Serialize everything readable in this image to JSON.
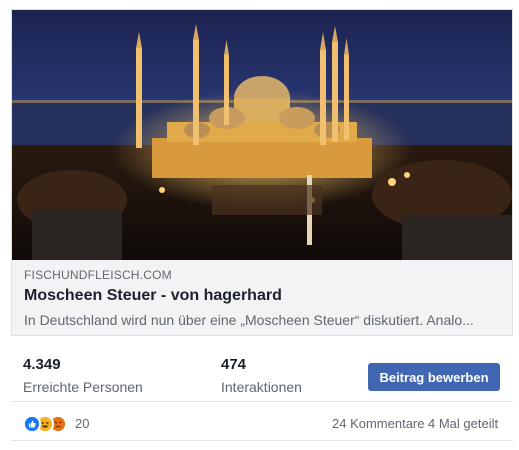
{
  "link_preview": {
    "image_alt": "Blaue Moschee Istanbul bei Nacht",
    "domain": "FISCHUNDFLEISCH.COM",
    "title": "Moscheen Steuer - von hagerhard",
    "description": "In Deutschland wird nun über eine „Moscheen Steuer“ diskutiert. Analo..."
  },
  "stats": {
    "reach_value": "4.349",
    "reach_label": "Erreichte Personen",
    "interactions_value": "474",
    "interactions_label": "Interaktionen",
    "promote_button": "Beitrag bewerben"
  },
  "reactions": {
    "icons": [
      "like-icon",
      "haha-icon",
      "angry-icon"
    ],
    "count": "20",
    "comments": "24 Kommentare",
    "shares": "4 Mal geteilt"
  },
  "colors": {
    "accent": "#4267b2",
    "text_secondary": "#606770",
    "meta_bg": "#f2f3f5"
  }
}
